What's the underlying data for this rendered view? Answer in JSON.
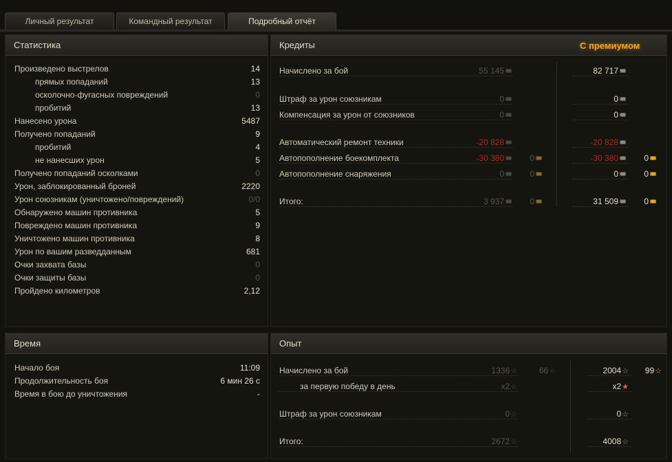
{
  "tabs": [
    "Личный результат",
    "Командный результат",
    "Подробный отчёт"
  ],
  "active_tab": 2,
  "stats": {
    "title": "Статистика",
    "rows": [
      {
        "label": "Произведено выстрелов",
        "value": "14",
        "indent": false,
        "dim": false
      },
      {
        "label": "прямых попаданий",
        "value": "13",
        "indent": true,
        "dim": false
      },
      {
        "label": "осколочно-фугасных повреждений",
        "value": "0",
        "indent": true,
        "dim": true
      },
      {
        "label": "пробитий",
        "value": "13",
        "indent": true,
        "dim": false
      },
      {
        "label": "Нанесено урона",
        "value": "5487",
        "indent": false,
        "dim": false
      },
      {
        "label": "Получено попаданий",
        "value": "9",
        "indent": false,
        "dim": false
      },
      {
        "label": "пробитий",
        "value": "4",
        "indent": true,
        "dim": false
      },
      {
        "label": "не нанесших урон",
        "value": "5",
        "indent": true,
        "dim": false
      },
      {
        "label": "Получено попаданий осколками",
        "value": "0",
        "indent": false,
        "dim": true
      },
      {
        "label": "Урон, заблокированный броней",
        "value": "2220",
        "indent": false,
        "dim": false
      },
      {
        "label": "Урон союзникам (уничтожено/повреждений)",
        "value": "0/0",
        "indent": false,
        "dim": true
      },
      {
        "label": "Обнаружено машин противника",
        "value": "5",
        "indent": false,
        "dim": false
      },
      {
        "label": "Повреждено машин противника",
        "value": "9",
        "indent": false,
        "dim": false
      },
      {
        "label": "Уничтожено машин противника",
        "value": "8",
        "indent": false,
        "dim": false
      },
      {
        "label": "Урон по вашим разведданным",
        "value": "681",
        "indent": false,
        "dim": false
      },
      {
        "label": "Очки захвата базы",
        "value": "0",
        "indent": false,
        "dim": true
      },
      {
        "label": "Очки защиты базы",
        "value": "0",
        "indent": false,
        "dim": true
      },
      {
        "label": "Пройдено километров",
        "value": "2,12",
        "indent": false,
        "dim": false
      }
    ]
  },
  "time": {
    "title": "Время",
    "rows": [
      {
        "label": "Начало боя",
        "value": "11:09"
      },
      {
        "label": "Продолжительность боя",
        "value": "6 мин 26 с"
      },
      {
        "label": "Время в бою до уничтожения",
        "value": "-"
      }
    ]
  },
  "credits": {
    "title": "Кредиты",
    "premium_label": "С премиумом",
    "rows": [
      {
        "label": "Начислено за бой",
        "base": "55 145",
        "base_style": "dim",
        "base_gold": null,
        "prem": "82 717",
        "prem_style": "",
        "prem_gold": null
      },
      {
        "label": "Штраф за урон союзникам",
        "base": "0",
        "base_style": "dim",
        "base_gold": null,
        "prem": "0",
        "prem_style": "",
        "prem_gold": null
      },
      {
        "label": "Компенсация за урон от союзников",
        "base": "0",
        "base_style": "dim",
        "base_gold": null,
        "prem": "0",
        "prem_style": "",
        "prem_gold": null
      },
      {
        "label": "Автоматический ремонт техники",
        "base": "-20 828",
        "base_style": "red",
        "base_gold": null,
        "prem": "-20 828",
        "prem_style": "red",
        "prem_gold": null
      },
      {
        "label": "Автопополнение боекомплекта",
        "base": "-30 380",
        "base_style": "red",
        "base_gold": "0",
        "prem": "-30 380",
        "prem_style": "red",
        "prem_gold": "0"
      },
      {
        "label": "Автопополнение снаряжения",
        "base": "0",
        "base_style": "dim",
        "base_gold": "0",
        "prem": "0",
        "prem_style": "",
        "prem_gold": "0"
      },
      {
        "label": "Итого:",
        "base": "3 937",
        "base_style": "dim",
        "base_gold": "0",
        "prem": "31 509",
        "prem_style": "",
        "prem_gold": "0"
      }
    ]
  },
  "experience": {
    "title": "Опыт",
    "rows": [
      {
        "label": "Начислено за бой",
        "indent": false,
        "base": "1336",
        "base_free": "66",
        "prem": "2004",
        "prem_free": "99"
      },
      {
        "label": "за первую победу в день",
        "indent": true,
        "base": "x2",
        "base_free": null,
        "prem": "x2",
        "prem_free": null
      },
      {
        "label": "Штраф за урон союзникам",
        "indent": false,
        "base": "0",
        "base_free": null,
        "prem": "0",
        "prem_free": null
      },
      {
        "label": "Итого:",
        "indent": false,
        "base": "2672",
        "base_free": null,
        "prem": "4008",
        "prem_free": null
      }
    ]
  }
}
